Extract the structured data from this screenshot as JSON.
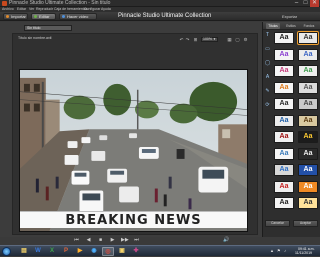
{
  "window": {
    "title": "Pinnacle Studio Ultimate Collection - Sin titulo",
    "min": "–",
    "max": "□",
    "close": "✕"
  },
  "menu": [
    "Archivo",
    "Editar",
    "Ver",
    "Reproducir",
    "Caja de herramientas",
    "Configurar",
    "Ayuda"
  ],
  "tabs": [
    {
      "label": "Importar",
      "color": "#e08a2c"
    },
    {
      "label": "Editar",
      "color": "#6fb14a",
      "active": true
    },
    {
      "label": "Hacer video",
      "color": "#4f8fd8"
    }
  ],
  "app_name": "Pinnacle Studio Ultimate Collection",
  "export_label": "Exportar",
  "editor": {
    "filename": "Sin titulo",
    "toolbar_label": "Título sin nombre.axtl",
    "zoom": "100%",
    "caption": "BREAKING NEWS",
    "transport": [
      "⏮",
      "◀",
      "■",
      "▶",
      "▶▶",
      "⏭",
      "🔊"
    ]
  },
  "panel": {
    "tabs": [
      "Títulos",
      "Estilos",
      "Fondos"
    ],
    "active_tab": 0,
    "side_tools": [
      "T",
      "▭",
      "◯",
      "A",
      "✎",
      "⟳"
    ],
    "styles": [
      {
        "text": "Aa",
        "bg": "#f2f2f2",
        "fg": "#222"
      },
      {
        "text": "Aa",
        "bg": "#e9e9e9",
        "fg": "#333"
      },
      {
        "text": "Aa",
        "bg": "#f4f4f4",
        "fg": "#8a3fd1"
      },
      {
        "text": "Aa",
        "bg": "#ececec",
        "fg": "#3b64c4"
      },
      {
        "text": "Aa",
        "bg": "#f5f5f5",
        "fg": "#c43b7b"
      },
      {
        "text": "Aa",
        "bg": "#efefef",
        "fg": "#3b9b4a"
      },
      {
        "text": "Aa",
        "bg": "#f5f5f5",
        "fg": "#e07a1a"
      },
      {
        "text": "Aa",
        "bg": "#dcdcdc",
        "fg": "#555"
      },
      {
        "text": "Aa",
        "bg": "#f3f3f3",
        "fg": "#2a2a2a"
      },
      {
        "text": "Aa",
        "bg": "#c9c9c9",
        "fg": "#444"
      },
      {
        "text": "Aa",
        "bg": "#ececec",
        "fg": "#1f5fa8"
      },
      {
        "text": "Aa",
        "bg": "#d9c9a0",
        "fg": "#5a3a10"
      },
      {
        "text": "Aa",
        "bg": "#f0f0f0",
        "fg": "#a01010"
      },
      {
        "text": "Aa",
        "bg": "#1c1c1c",
        "fg": "#ffcc33"
      },
      {
        "text": "Aa",
        "bg": "#f5f5f5",
        "fg": "#3a7ab8"
      },
      {
        "text": "Aa",
        "bg": "#2a2a2a",
        "fg": "#eeeeee"
      },
      {
        "text": "Aa",
        "bg": "#d8d8d8",
        "fg": "#2c6ec4"
      },
      {
        "text": "Aa",
        "bg": "#2350a8",
        "fg": "#ffffff"
      },
      {
        "text": "Aa",
        "bg": "#efefef",
        "fg": "#c62020"
      },
      {
        "text": "Aa",
        "bg": "#f08a24",
        "fg": "#ffffff"
      },
      {
        "text": "Aa",
        "bg": "#f4f4f4",
        "fg": "#222"
      },
      {
        "text": "Aa",
        "bg": "#ffe29a",
        "fg": "#333"
      }
    ],
    "selected_style": 1,
    "buttons": [
      "Cancelar",
      "Aceptar"
    ]
  },
  "taskbar": {
    "apps": [
      {
        "name": "folder",
        "glyph": "▤",
        "color": "#f4d36a"
      },
      {
        "name": "word",
        "glyph": "W",
        "color": "#3a7be0"
      },
      {
        "name": "excel",
        "glyph": "X",
        "color": "#3fa54b"
      },
      {
        "name": "powerpoint",
        "glyph": "P",
        "color": "#e0643a"
      },
      {
        "name": "media",
        "glyph": "▶",
        "color": "#ffb02e"
      },
      {
        "name": "browser",
        "glyph": "◉",
        "color": "#4cb0ff"
      },
      {
        "name": "pinnacle",
        "glyph": "◎",
        "color": "#e14a3a",
        "active": true
      },
      {
        "name": "folder2",
        "glyph": "▣",
        "color": "#f4d36a"
      },
      {
        "name": "app",
        "glyph": "✚",
        "color": "#d24b8e"
      }
    ],
    "time": "09:41 a.m.",
    "date": "11/11/2019"
  }
}
